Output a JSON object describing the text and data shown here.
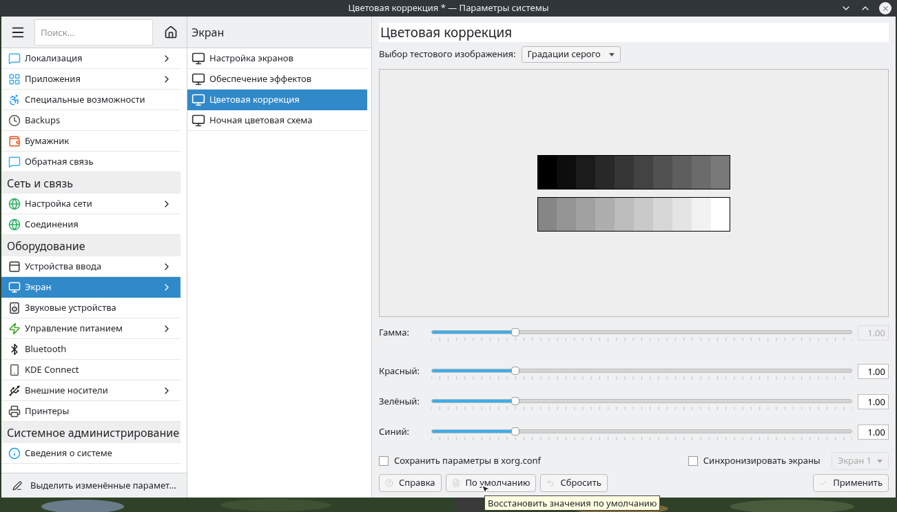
{
  "window": {
    "title": "Цветовая коррекция * — Параметры системы"
  },
  "sidebar": {
    "search": {
      "placeholder": "Поиск..."
    },
    "items": [
      {
        "kind": "item",
        "label": "Локализация",
        "has_children": true,
        "selected": false
      },
      {
        "kind": "item",
        "label": "Приложения",
        "has_children": true,
        "selected": false
      },
      {
        "kind": "item",
        "label": "Специальные возможности",
        "has_children": false,
        "selected": false
      },
      {
        "kind": "item",
        "label": "Backups",
        "has_children": false,
        "selected": false
      },
      {
        "kind": "item",
        "label": "Бумажник",
        "has_children": false,
        "selected": false
      },
      {
        "kind": "item",
        "label": "Обратная связь",
        "has_children": false,
        "selected": false
      },
      {
        "kind": "header",
        "label": "Сеть и связь"
      },
      {
        "kind": "item",
        "label": "Настройка сети",
        "has_children": true,
        "selected": false
      },
      {
        "kind": "item",
        "label": "Соединения",
        "has_children": false,
        "selected": false
      },
      {
        "kind": "header",
        "label": "Оборудование"
      },
      {
        "kind": "item",
        "label": "Устройства ввода",
        "has_children": true,
        "selected": false
      },
      {
        "kind": "item",
        "label": "Экран",
        "has_children": true,
        "selected": true
      },
      {
        "kind": "item",
        "label": "Звуковые устройства",
        "has_children": false,
        "selected": false
      },
      {
        "kind": "item",
        "label": "Управление питанием",
        "has_children": true,
        "selected": false
      },
      {
        "kind": "item",
        "label": "Bluetooth",
        "has_children": false,
        "selected": false
      },
      {
        "kind": "item",
        "label": "KDE Connect",
        "has_children": false,
        "selected": false
      },
      {
        "kind": "item",
        "label": "Внешние носители",
        "has_children": true,
        "selected": false
      },
      {
        "kind": "item",
        "label": "Принтеры",
        "has_children": false,
        "selected": false
      },
      {
        "kind": "header",
        "label": "Системное администрирование"
      },
      {
        "kind": "item",
        "label": "Сведения о системе",
        "has_children": false,
        "selected": false
      }
    ],
    "footer": "Выделить изменённые парамет..."
  },
  "subpanel": {
    "title": "Экран",
    "items": [
      {
        "label": "Настройка экранов",
        "selected": false
      },
      {
        "label": "Обеспечение эффектов",
        "selected": false
      },
      {
        "label": "Цветовая коррекция",
        "selected": true
      },
      {
        "label": "Ночная цветовая схема",
        "selected": false
      }
    ]
  },
  "page": {
    "title": "Цветовая коррекция",
    "test_image_label": "Выбор тестового изображения:",
    "test_image_value": "Градации серого",
    "sliders": [
      {
        "label": "Гамма:",
        "level": 0.2,
        "reading": "1.00",
        "disabled": true
      },
      {
        "label": "Красный:",
        "level": 0.2,
        "reading": "1.00",
        "disabled": false
      },
      {
        "label": "Зелёный:",
        "level": 0.2,
        "reading": "1.00",
        "disabled": false
      },
      {
        "label": "Синий:",
        "level": 0.2,
        "reading": "1.00",
        "disabled": false
      }
    ],
    "save_xorg": {
      "label": "Сохранить параметры в xorg.conf",
      "checked": false
    },
    "sync_screens": {
      "label": "Синхронизировать экраны",
      "checked": false
    },
    "screen_select": {
      "value": "Экран 1",
      "disabled": true
    },
    "buttons": [
      "Справка",
      "По умолчанию",
      "Сбросить"
    ],
    "apply": "Применить"
  },
  "tooltip": "Восстановить значения по умолчанию"
}
